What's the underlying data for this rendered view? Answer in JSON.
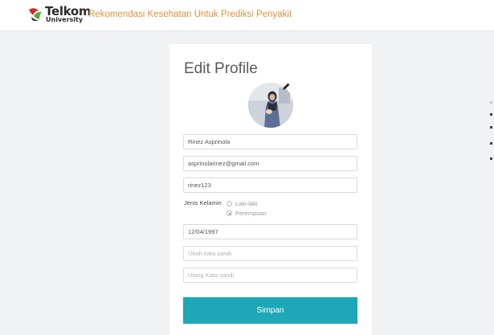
{
  "header": {
    "logo_line1": "Telkom",
    "logo_line2": "University",
    "app_title": "Rekomendasi Kesehatan Untuk Prediksi Penyakit"
  },
  "form": {
    "title": "Edit Profile",
    "name_value": "Rinez Asprinola",
    "email_value": "asprinolarinez@gmail.com",
    "username_value": "rinez123",
    "gender_label": "Jenis Kelamin",
    "gender_options": [
      {
        "label": "Laki-laki",
        "checked": false
      },
      {
        "label": "Perempuan",
        "checked": true
      }
    ],
    "birthdate_value": "12/04/1997",
    "new_password_placeholder": "Ubah kata sandi",
    "confirm_password_placeholder": "Ulang Kata sandi",
    "submit_label": "Simpan"
  },
  "colors": {
    "accent": "#1ea7b7",
    "title_orange": "#e0913a",
    "logo_red": "#d9252a",
    "logo_green": "#5aa832"
  },
  "icons": {
    "logo": "telkom-logo-icon",
    "edit": "pencil-icon"
  }
}
